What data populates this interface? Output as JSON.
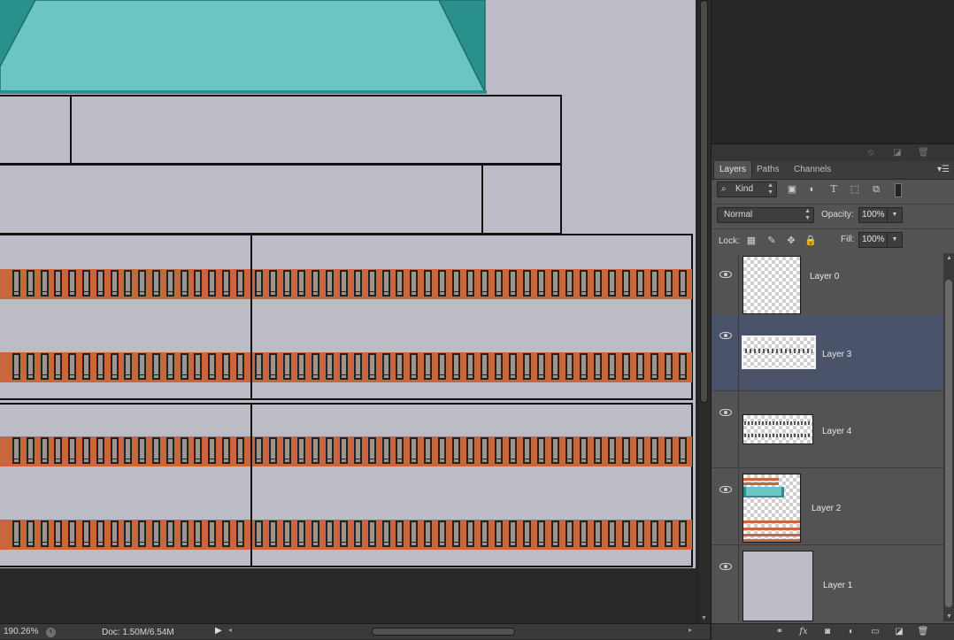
{
  "status_bar": {
    "zoom": "190.26%",
    "doc_info": "Doc: 1.50M/6.54M"
  },
  "layers_panel": {
    "tabs": [
      "Layers",
      "Paths",
      "Channels"
    ],
    "active_tab": "Layers",
    "filter": {
      "kind_label": "Kind"
    },
    "blend_mode": "Normal",
    "opacity": {
      "label": "Opacity:",
      "value": "100%"
    },
    "lock": {
      "label": "Lock:"
    },
    "fill": {
      "label": "Fill:",
      "value": "100%"
    },
    "layers": [
      {
        "name": "Layer 0",
        "visible": true,
        "selected": false
      },
      {
        "name": "Layer 3",
        "visible": true,
        "selected": true
      },
      {
        "name": "Layer 4",
        "visible": true,
        "selected": false
      },
      {
        "name": "Layer 2",
        "visible": true,
        "selected": false
      },
      {
        "name": "Layer 1",
        "visible": true,
        "selected": false
      }
    ]
  },
  "colors": {
    "canvas_bg": "#bbbcc5",
    "roof_teal": "#6ac5c3",
    "roof_dark": "#2a908c",
    "window_band": "#c9663e",
    "window_fill": "#9a968d",
    "selected_layer": "#4a5369"
  }
}
